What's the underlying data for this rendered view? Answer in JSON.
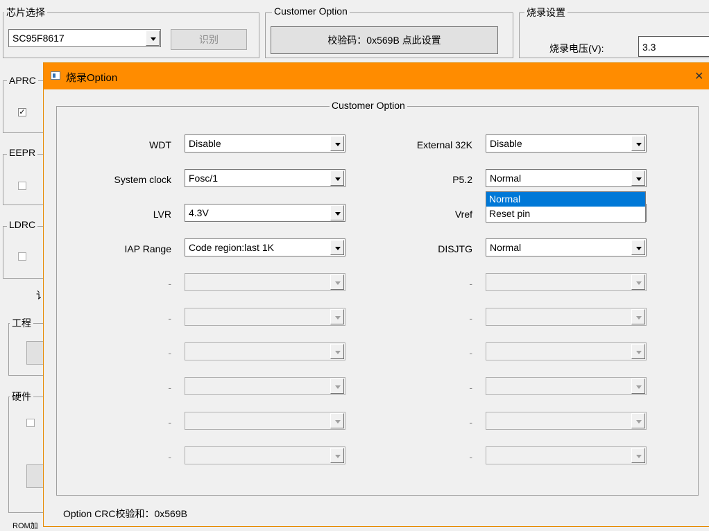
{
  "background": {
    "chip_select": {
      "label": "芯片选择",
      "value": "SC95F8617",
      "identify_button": "识别"
    },
    "customer_option": {
      "label": "Customer Option",
      "checksum_button": "校验码：0x569B 点此设置"
    },
    "burn_settings": {
      "label": "烧录设置",
      "voltage_label": "烧录电压(V):",
      "voltage_value": "3.3"
    },
    "side_labels": {
      "aprom": "APRC",
      "eeprom": "EEPR",
      "ldrom": "LDRC",
      "setting_fragment": "讠",
      "project": "工程",
      "hardware": "硬件",
      "bottom": "ROM加"
    },
    "aprom_checked": true
  },
  "dialog": {
    "title": "烧录Option",
    "icon": "window-app-icon",
    "close_glyph": "✕",
    "group_label": "Customer Option",
    "left_rows": [
      {
        "label": "WDT",
        "value": "Disable",
        "enabled": true
      },
      {
        "label": "System clock",
        "value": "Fosc/1",
        "enabled": true
      },
      {
        "label": "LVR",
        "value": "4.3V",
        "enabled": true
      },
      {
        "label": "IAP Range",
        "value": "Code region:last 1K",
        "enabled": true
      },
      {
        "label": "-",
        "value": "",
        "enabled": false
      },
      {
        "label": "-",
        "value": "",
        "enabled": false
      },
      {
        "label": "-",
        "value": "",
        "enabled": false
      },
      {
        "label": "-",
        "value": "",
        "enabled": false
      },
      {
        "label": "-",
        "value": "",
        "enabled": false
      },
      {
        "label": "-",
        "value": "",
        "enabled": false
      }
    ],
    "right_rows": [
      {
        "label": "External 32K",
        "value": "Disable",
        "enabled": true
      },
      {
        "label": "P5.2",
        "value": "Normal",
        "enabled": true
      },
      {
        "label": "Vref",
        "value": "",
        "enabled": true
      },
      {
        "label": "DISJTG",
        "value": "Normal",
        "enabled": true
      },
      {
        "label": "-",
        "value": "",
        "enabled": false
      },
      {
        "label": "-",
        "value": "",
        "enabled": false
      },
      {
        "label": "-",
        "value": "",
        "enabled": false
      },
      {
        "label": "-",
        "value": "",
        "enabled": false
      },
      {
        "label": "-",
        "value": "",
        "enabled": false
      },
      {
        "label": "-",
        "value": "",
        "enabled": false
      }
    ],
    "open_dropdown": {
      "options": [
        "Normal",
        "Reset pin"
      ],
      "highlighted": "Normal"
    },
    "footer": "Option CRC校验和：0x569B"
  },
  "colors": {
    "title_bar": "#ff8c00",
    "highlight": "#0078d7"
  }
}
